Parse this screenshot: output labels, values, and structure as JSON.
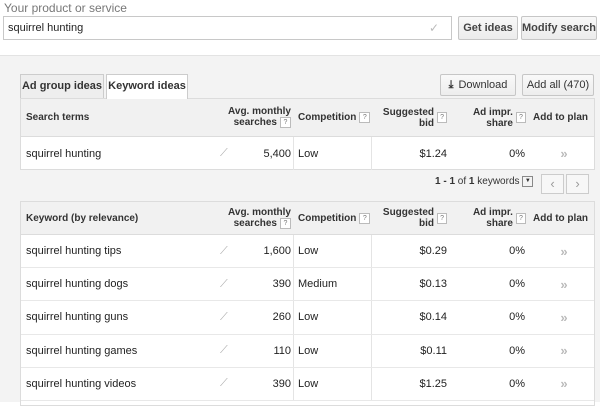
{
  "search": {
    "label": "Your product or service",
    "value": "squirrel hunting",
    "get_ideas": "Get ideas",
    "modify_search": "Modify search"
  },
  "tabs": [
    {
      "label": "Ad group ideas",
      "active": false
    },
    {
      "label": "Keyword ideas",
      "active": true
    }
  ],
  "actions": {
    "download": "Download",
    "add_all": "Add all (470)"
  },
  "columns": {
    "search_terms": "Search terms",
    "keyword": "Keyword (by relevance)",
    "avg_monthly_1": "Avg. monthly",
    "avg_monthly_2": "searches",
    "competition": "Competition",
    "suggested_bid": "Suggested bid",
    "ad_impr_share": "Ad impr. share",
    "add_to_plan": "Add to plan"
  },
  "search_terms_rows": [
    {
      "keyword": "squirrel hunting",
      "searches": "5,400",
      "competition": "Low",
      "bid": "$1.24",
      "share": "0%"
    }
  ],
  "pagination": {
    "range": "1 - 1",
    "of_label": "of",
    "total": "1",
    "unit": "keywords"
  },
  "keyword_rows": [
    {
      "keyword": "squirrel hunting tips",
      "searches": "1,600",
      "competition": "Low",
      "bid": "$0.29",
      "share": "0%"
    },
    {
      "keyword": "squirrel hunting dogs",
      "searches": "390",
      "competition": "Medium",
      "bid": "$0.13",
      "share": "0%"
    },
    {
      "keyword": "squirrel hunting guns",
      "searches": "260",
      "competition": "Low",
      "bid": "$0.14",
      "share": "0%"
    },
    {
      "keyword": "squirrel hunting games",
      "searches": "110",
      "competition": "Low",
      "bid": "$0.11",
      "share": "0%"
    },
    {
      "keyword": "squirrel hunting videos",
      "searches": "390",
      "competition": "Low",
      "bid": "$1.25",
      "share": "0%"
    }
  ]
}
